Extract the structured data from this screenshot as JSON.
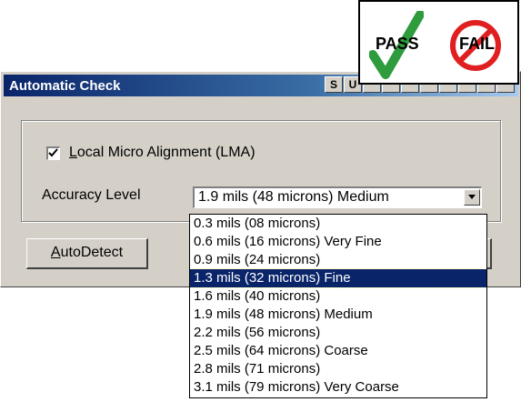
{
  "window": {
    "title": "Automatic Check",
    "title_buttons": [
      "S",
      "U"
    ]
  },
  "lma": {
    "checked": true,
    "label_prefix": "",
    "label_underlined": "L",
    "label_rest": "ocal Micro Alignment (LMA)"
  },
  "accuracy": {
    "label": "Accuracy Level",
    "selected_value": "1.9 mils (48 microns) Medium",
    "options": [
      "0.3 mils (08 microns)",
      "0.6 mils (16 microns) Very Fine",
      "0.9 mils (24 microns)",
      "1.3 mils (32 microns) Fine",
      "1.6 mils (40 microns)",
      "1.9 mils (48 microns) Medium",
      "2.2 mils (56 microns)",
      "2.5 mils (64 microns) Coarse",
      "2.8 mils (71 microns)",
      "3.1 mils (79 microns) Very Coarse"
    ],
    "highlighted_index": 3
  },
  "buttons": {
    "autodetect_underlined": "A",
    "autodetect_rest": "utoDetect"
  },
  "badge": {
    "pass_label": "PASS",
    "fail_label": "FAIL",
    "pass_icon": "checkmark-icon",
    "fail_icon": "prohibited-icon",
    "pass_color": "#2e9b3c",
    "fail_color": "#e02020"
  }
}
